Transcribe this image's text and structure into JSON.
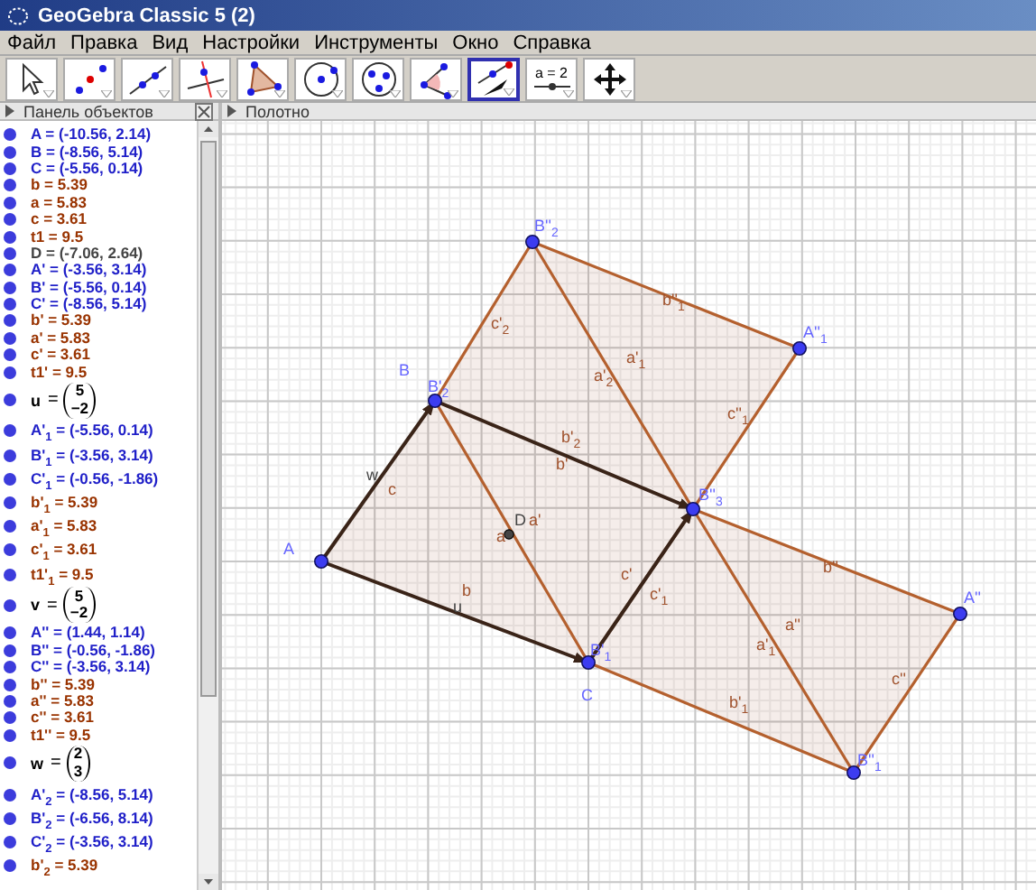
{
  "window": {
    "title": "GeoGebra Classic 5 (2)"
  },
  "menu": [
    "Файл",
    "Правка",
    "Вид",
    "Настройки",
    "Инструменты",
    "Окно",
    "Справка"
  ],
  "toolbar": [
    {
      "kind": "move",
      "selected": false
    },
    {
      "kind": "point",
      "selected": false
    },
    {
      "kind": "line",
      "selected": false
    },
    {
      "kind": "perpendicular",
      "selected": false
    },
    {
      "kind": "polygon",
      "selected": false
    },
    {
      "kind": "circle",
      "selected": false
    },
    {
      "kind": "conic",
      "selected": false
    },
    {
      "kind": "angle",
      "selected": false
    },
    {
      "kind": "vector",
      "selected": true
    },
    {
      "kind": "slider",
      "selected": false,
      "label": "a = 2"
    },
    {
      "kind": "move-view",
      "selected": false
    }
  ],
  "algebra_view": {
    "title": "Панель объектов",
    "items": [
      {
        "kind": "text",
        "text": "A = (-10.56, 2.14)",
        "color": "#1f1fc8"
      },
      {
        "kind": "text",
        "text": "B = (-8.56, 5.14)",
        "color": "#1f1fc8"
      },
      {
        "kind": "text",
        "text": "C = (-5.56, 0.14)",
        "color": "#1f1fc8"
      },
      {
        "kind": "text",
        "text": "b = 5.39",
        "color": "#993300"
      },
      {
        "kind": "text",
        "text": "a = 5.83",
        "color": "#993300"
      },
      {
        "kind": "text",
        "text": "c = 3.61",
        "color": "#993300"
      },
      {
        "kind": "text",
        "text": "t1 = 9.5",
        "color": "#993300"
      },
      {
        "kind": "text",
        "text": "D = (-7.06, 2.64)",
        "color": "#444444"
      },
      {
        "kind": "text",
        "text": "A' = (-3.56, 3.14)",
        "color": "#1f1fc8"
      },
      {
        "kind": "text",
        "text": "B' = (-5.56, 0.14)",
        "color": "#1f1fc8"
      },
      {
        "kind": "text",
        "text": "C' = (-8.56, 5.14)",
        "color": "#1f1fc8"
      },
      {
        "kind": "text",
        "text": "b' = 5.39",
        "color": "#993300"
      },
      {
        "kind": "text",
        "text": "a' = 5.83",
        "color": "#993300"
      },
      {
        "kind": "text",
        "text": "c' = 3.61",
        "color": "#993300"
      },
      {
        "kind": "text",
        "text": "t1' = 9.5",
        "color": "#993300"
      },
      {
        "kind": "vector",
        "name": "u",
        "sign": "=",
        "components": [
          "5",
          "−2"
        ]
      },
      {
        "kind": "text",
        "text": "A'$_{1}$ = (-5.56, 0.14)",
        "color": "#1f1fc8"
      },
      {
        "kind": "text",
        "text": "B'$_{1}$ = (-3.56, 3.14)",
        "color": "#1f1fc8"
      },
      {
        "kind": "text",
        "text": "C'$_{1}$ = (-0.56, -1.86)",
        "color": "#1f1fc8"
      },
      {
        "kind": "text",
        "text": "b'$_{1}$ = 5.39",
        "color": "#993300"
      },
      {
        "kind": "text",
        "text": "a'$_{1}$ = 5.83",
        "color": "#993300"
      },
      {
        "kind": "text",
        "text": "c'$_{1}$ = 3.61",
        "color": "#993300"
      },
      {
        "kind": "text",
        "text": "t1'$_{1}$ = 9.5",
        "color": "#993300"
      },
      {
        "kind": "vector",
        "name": "v",
        "sign": "=",
        "components": [
          "5",
          "−2"
        ]
      },
      {
        "kind": "text",
        "text": "A'' = (1.44, 1.14)",
        "color": "#1f1fc8"
      },
      {
        "kind": "text",
        "text": "B'' = (-0.56, -1.86)",
        "color": "#1f1fc8"
      },
      {
        "kind": "text",
        "text": "C'' = (-3.56, 3.14)",
        "color": "#1f1fc8"
      },
      {
        "kind": "text",
        "text": "b'' = 5.39",
        "color": "#993300"
      },
      {
        "kind": "text",
        "text": "a'' = 5.83",
        "color": "#993300"
      },
      {
        "kind": "text",
        "text": "c'' = 3.61",
        "color": "#993300"
      },
      {
        "kind": "text",
        "text": "t1'' = 9.5",
        "color": "#993300"
      },
      {
        "kind": "vector",
        "name": "w",
        "sign": "=",
        "components": [
          "2",
          "3"
        ]
      },
      {
        "kind": "text",
        "text": "A'$_{2}$ = (-8.56, 5.14)",
        "color": "#1f1fc8"
      },
      {
        "kind": "text",
        "text": "B'$_{2}$ = (-6.56, 8.14)",
        "color": "#1f1fc8"
      },
      {
        "kind": "text",
        "text": "C'$_{2}$ = (-3.56, 3.14)",
        "color": "#1f1fc8"
      },
      {
        "kind": "text",
        "text": "b'$_{2}$ = 5.39",
        "color": "#993300"
      }
    ]
  },
  "graphics_view": {
    "title": "Полотно",
    "labels": [
      {
        "text": "B''$_{2}$",
        "color": "#6666ff"
      },
      {
        "text": "A''$_{1}$",
        "color": "#6666ff"
      },
      {
        "text": "b''$_{1}$",
        "color": "#a0522d"
      },
      {
        "text": "c'$_{2}$",
        "color": "#a0522d"
      },
      {
        "text": "a'$_{1}$",
        "color": "#a0522d"
      },
      {
        "text": "a'$_{2}$",
        "color": "#a0522d"
      },
      {
        "text": "c''$_{1}$",
        "color": "#a0522d"
      },
      {
        "text": "B",
        "color": "#6666ff"
      },
      {
        "text": "B'$_{2}$",
        "color": "#6666ff"
      },
      {
        "text": "b'$_{2}$",
        "color": "#a0522d"
      },
      {
        "text": "b'",
        "color": "#a0522d"
      },
      {
        "text": "w",
        "color": "#444444"
      },
      {
        "text": "c",
        "color": "#a0522d"
      },
      {
        "text": "B''$_{3}$",
        "color": "#6666ff"
      },
      {
        "text": "D",
        "color": "#444444"
      },
      {
        "text": "a'",
        "color": "#a0522d"
      },
      {
        "text": "a",
        "color": "#a0522d"
      },
      {
        "text": "A",
        "color": "#6666ff"
      },
      {
        "text": "b",
        "color": "#a0522d"
      },
      {
        "text": "u",
        "color": "#444444"
      },
      {
        "text": "c'",
        "color": "#a0522d"
      },
      {
        "text": "c'$_{1}$",
        "color": "#a0522d"
      },
      {
        "text": "B'$_{1}$",
        "color": "#6666ff"
      },
      {
        "text": "C",
        "color": "#6666ff"
      },
      {
        "text": "b''",
        "color": "#a0522d"
      },
      {
        "text": "a''",
        "color": "#a0522d"
      },
      {
        "text": "a'$_{1}$",
        "color": "#a0522d"
      },
      {
        "text": "c''",
        "color": "#a0522d"
      },
      {
        "text": "b'$_{1}$",
        "color": "#a0522d"
      },
      {
        "text": "A''",
        "color": "#6666ff"
      },
      {
        "text": "B''$_{1}$",
        "color": "#6666ff"
      }
    ]
  }
}
